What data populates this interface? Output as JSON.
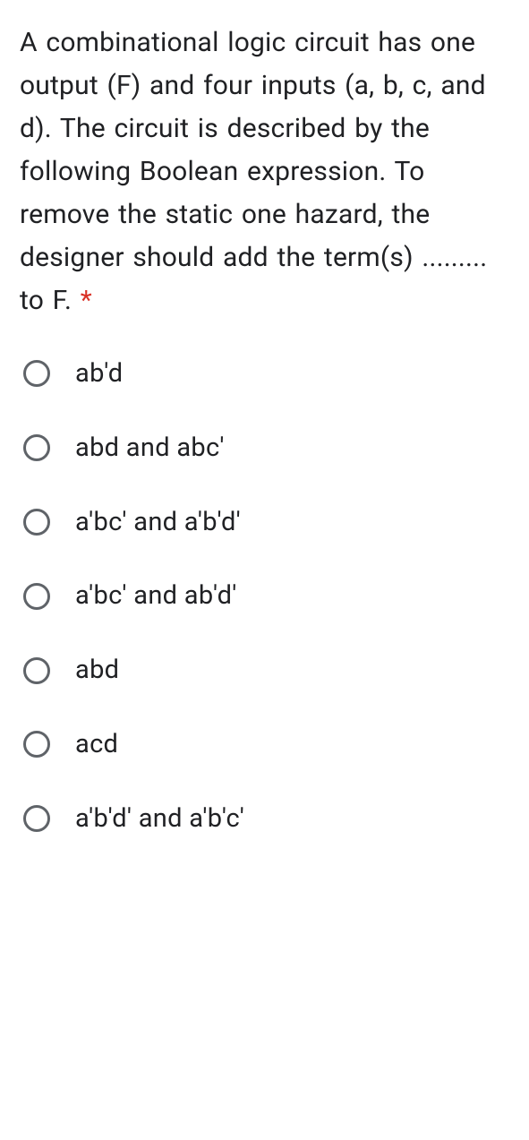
{
  "question": {
    "text": "A combinational logic circuit has one output (F) and four inputs (a, b, c, and d). The circuit is described by the following Boolean expression. To remove the static one hazard, the designer should add the term(s) ......... to F.",
    "required_marker": " *"
  },
  "options": [
    {
      "label": "ab'd"
    },
    {
      "label": "abd and abc'"
    },
    {
      "label": "a'bc' and a'b'd'"
    },
    {
      "label": "a'bc' and ab'd'"
    },
    {
      "label": "abd"
    },
    {
      "label": "acd"
    },
    {
      "label": "a'b'd' and a'b'c'"
    }
  ]
}
